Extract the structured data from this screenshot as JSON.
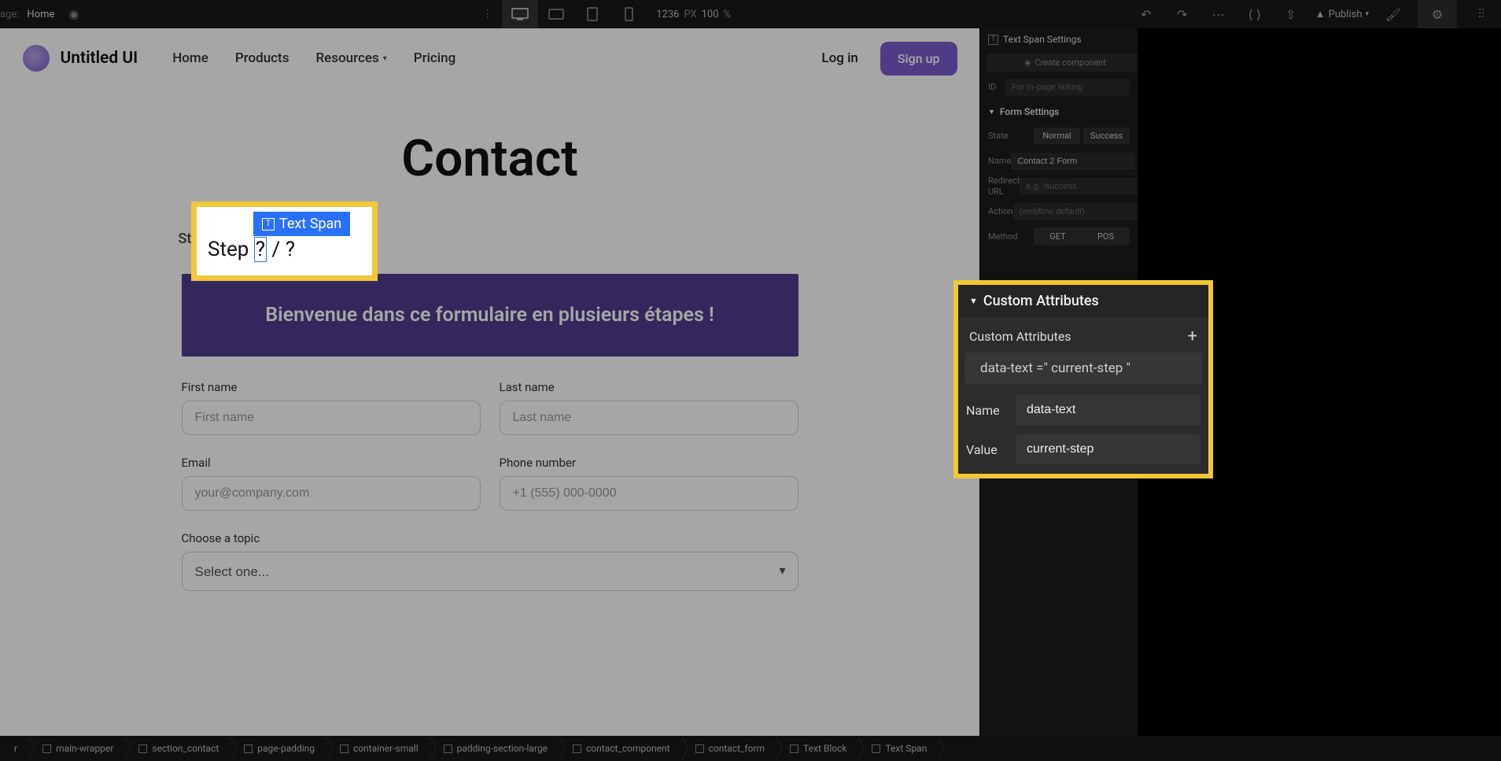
{
  "topbar": {
    "page_label": "age:",
    "page_name": "Home",
    "viewport_width": "1236",
    "viewport_unit": "PX",
    "zoom": "100",
    "zoom_unit": "%",
    "publish_label": "Publish"
  },
  "site": {
    "logo_text": "Untitled UI",
    "nav": {
      "home": "Home",
      "products": "Products",
      "resources": "Resources",
      "pricing": "Pricing"
    },
    "login": "Log in",
    "signup": "Sign up",
    "page_title": "Contact",
    "step_indicator": "Step ? / ?",
    "banner_text": "Bienvenue dans ce formulaire en plusieurs étapes !",
    "form": {
      "first_name_label": "First name",
      "first_name_placeholder": "First name",
      "last_name_label": "Last name",
      "last_name_placeholder": "Last name",
      "email_label": "Email",
      "email_placeholder": "your@company.com",
      "phone_label": "Phone number",
      "phone_placeholder": "+1 (555) 000-0000",
      "topic_label": "Choose a topic",
      "topic_selected": "Select one..."
    }
  },
  "step_popup": {
    "label_text": "Text Span",
    "step_text_prefix": "Step ",
    "step_text_sel": "?",
    "step_text_suffix": " / ?"
  },
  "panel": {
    "heading_textspan": "Text Span Settings",
    "create_component": "Create component",
    "id_label": "ID",
    "id_placeholder": "For in-page linking",
    "form_settings": "Form Settings",
    "state_label": "State",
    "state_normal": "Normal",
    "state_success": "Success",
    "name_label": "Name",
    "name_value": "Contact 2 Form",
    "redirect_label": "Redirect URL",
    "redirect_placeholder": "e.g. /success",
    "action_label": "Action",
    "action_value": "(webflow default)",
    "method_label": "Method",
    "method_get": "GET",
    "method_post": "POS"
  },
  "custom_attr": {
    "header": "Custom Attributes",
    "sub_label": "Custom Attributes",
    "string": "data-text =\" current-step \"",
    "name_label": "Name",
    "name_value": "data-text",
    "value_label": "Value",
    "value_value": "current-step"
  },
  "breadcrumb": [
    "r",
    "main-wrapper",
    "section_contact",
    "page-padding",
    "container-small",
    "padding-section-large",
    "contact_component",
    "contact_form",
    "Text Block",
    "Text Span"
  ]
}
